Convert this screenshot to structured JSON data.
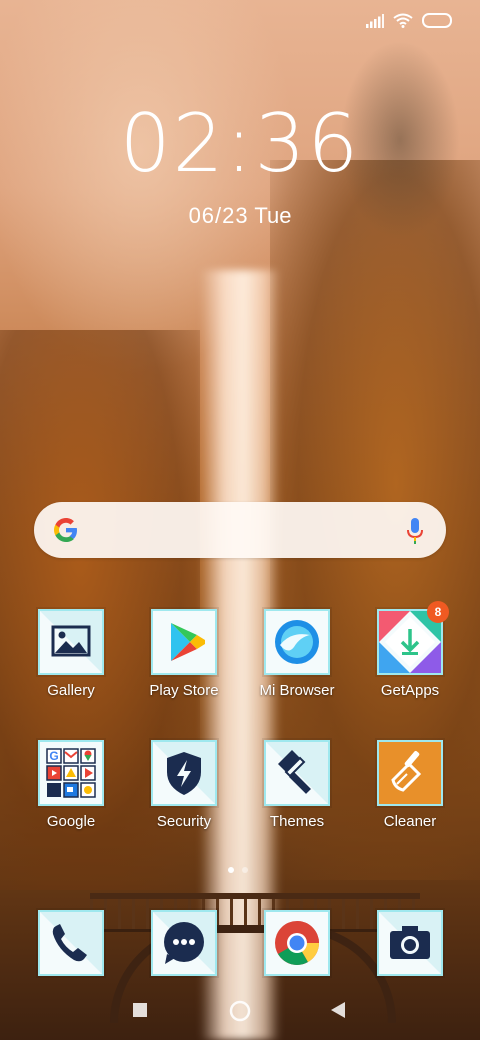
{
  "status_bar": {
    "icons": [
      "signal-icon",
      "wifi-icon",
      "battery-icon"
    ]
  },
  "lockclock": {
    "time": "02:36",
    "date": "06/23",
    "weekday": "Tue"
  },
  "search_bar": {
    "icons": [
      "google-logo-icon",
      "microphone-icon"
    ]
  },
  "home_apps": [
    {
      "label": "Gallery",
      "icon": "gallery-icon"
    },
    {
      "label": "Play Store",
      "icon": "play-store-icon"
    },
    {
      "label": "Mi Browser",
      "icon": "mi-browser-icon"
    },
    {
      "label": "GetApps",
      "icon": "getapps-icon",
      "badge": "8"
    },
    {
      "label": "Google",
      "icon": "google-folder-icon"
    },
    {
      "label": "Security",
      "icon": "security-icon"
    },
    {
      "label": "Themes",
      "icon": "themes-icon"
    },
    {
      "label": "Cleaner",
      "icon": "cleaner-icon"
    }
  ],
  "page_indicator": {
    "pages": 2,
    "current": 1
  },
  "dock": [
    "phone-icon",
    "messages-icon",
    "chrome-icon",
    "camera-icon"
  ],
  "nav_bar": [
    "recents-button",
    "home-button",
    "back-button"
  ],
  "colors": {
    "badge": "#f05a22",
    "tile_border": "#9fe8ee",
    "icon_navy": "#1b2c4f"
  }
}
